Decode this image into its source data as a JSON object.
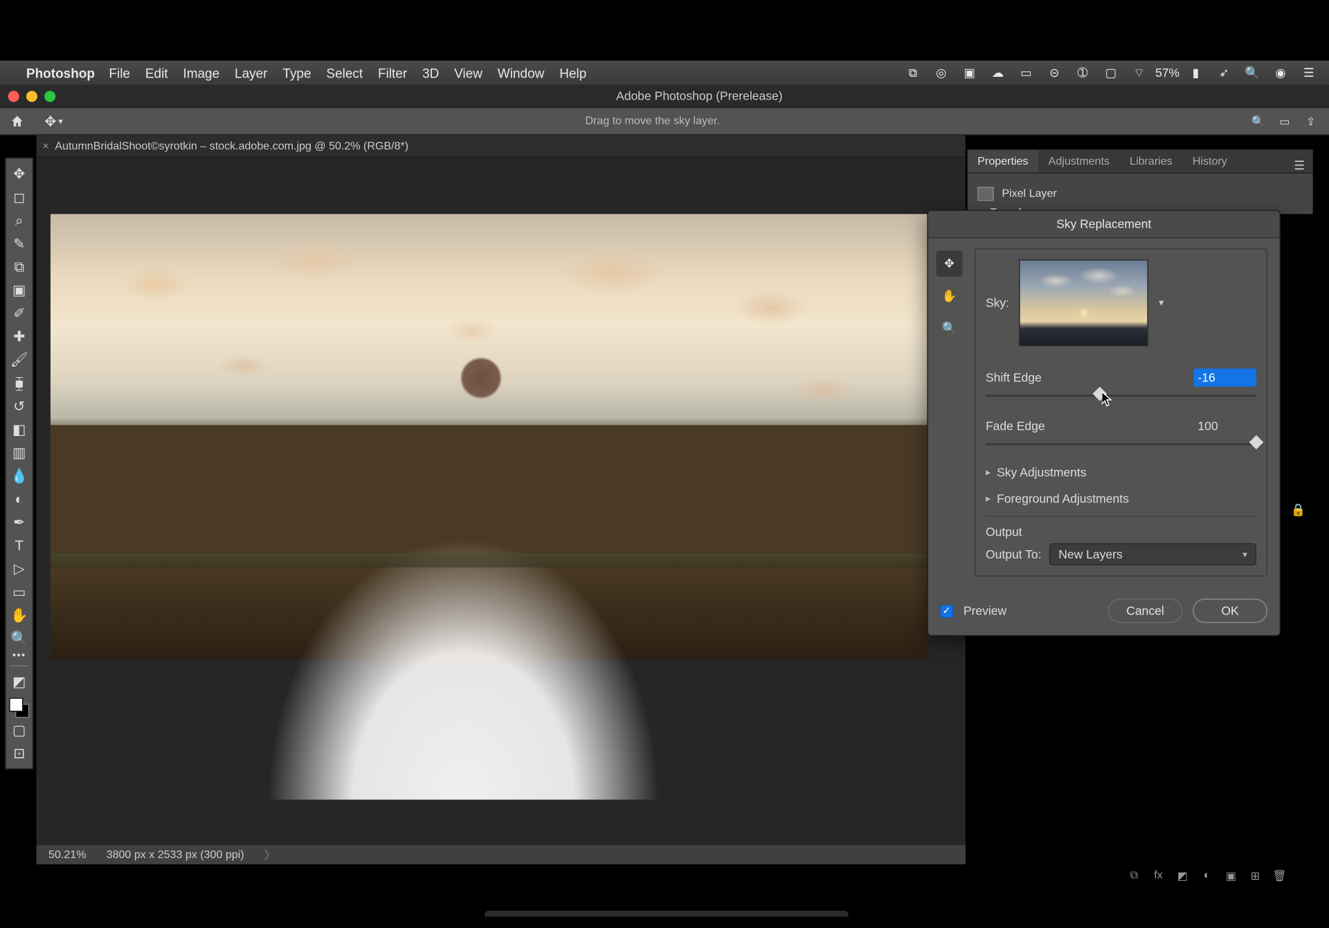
{
  "menubar": {
    "app": "Photoshop",
    "items": [
      "File",
      "Edit",
      "Image",
      "Layer",
      "Type",
      "Select",
      "Filter",
      "3D",
      "View",
      "Window",
      "Help"
    ],
    "battery": "57%"
  },
  "titlebar": {
    "title": "Adobe Photoshop (Prerelease)"
  },
  "optionsbar": {
    "tip": "Drag to move the sky layer."
  },
  "doctab": {
    "name": "AutumnBridalShoot©syrotkin – stock.adobe.com.jpg @ 50.2% (RGB/8*)"
  },
  "statusbar": {
    "zoom": "50.21%",
    "dims": "3800 px x 2533 px (300 ppi)"
  },
  "panels": {
    "tabs": [
      "Properties",
      "Adjustments",
      "Libraries",
      "History"
    ],
    "pixel_layer": "Pixel Layer",
    "transform": "Transform"
  },
  "dialog": {
    "title": "Sky Replacement",
    "sky_label": "Sky:",
    "shift_edge_label": "Shift Edge",
    "shift_edge_value": "-16",
    "fade_edge_label": "Fade Edge",
    "fade_edge_value": "100",
    "sky_adjustments": "Sky Adjustments",
    "fg_adjustments": "Foreground Adjustments",
    "output_title": "Output",
    "output_to_label": "Output To:",
    "output_to_value": "New Layers",
    "preview": "Preview",
    "cancel": "Cancel",
    "ok": "OK"
  }
}
